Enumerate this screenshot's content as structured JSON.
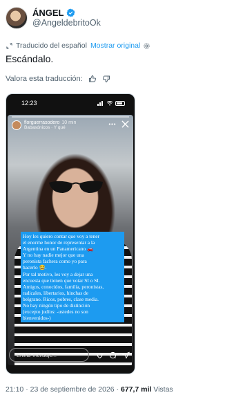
{
  "author": {
    "display_name": "ÁNGEL",
    "handle": "@AngeldebritoOk",
    "verified_color": "#1d9bf0"
  },
  "translation": {
    "label": "Traducido del español",
    "link": "Mostrar original"
  },
  "tweet_text": "Escándalo.",
  "rate": {
    "label": "Valora esta traducción:"
  },
  "media": {
    "status_time": "12:23",
    "story_user": "florguerrasodero",
    "story_time": "10 min",
    "story_audio": "Babasónicos · Y qué",
    "caption_lines": [
      "Hoy les quiero contar que voy a tener",
      "el enorme honor de representar a la",
      "Argentina en un Panamericano 🚗",
      "Y no hay nadie mejor que una",
      "peronista fachera como yo para",
      "hacerlo 😂.",
      "Por tal motivo, les voy a dejar una",
      "encuesta que tienen que votar SI o SI.",
      "Amigos, conocidos, familia, peronistas,",
      "radicales, libertarios, hinchas de",
      "belgrano. Ricos, pobres, clase media.",
      "No hay ningún tipo de distinción",
      "(excepto judíos: -ustedes no son",
      "bienvenidos-)"
    ],
    "reply_placeholder": "Enviar mensaje..."
  },
  "footer": {
    "time": "21:10",
    "separator": " · ",
    "date": "23 de septiembre de 2026",
    "views_count": "677,7 mil",
    "views_label": "Vistas"
  }
}
